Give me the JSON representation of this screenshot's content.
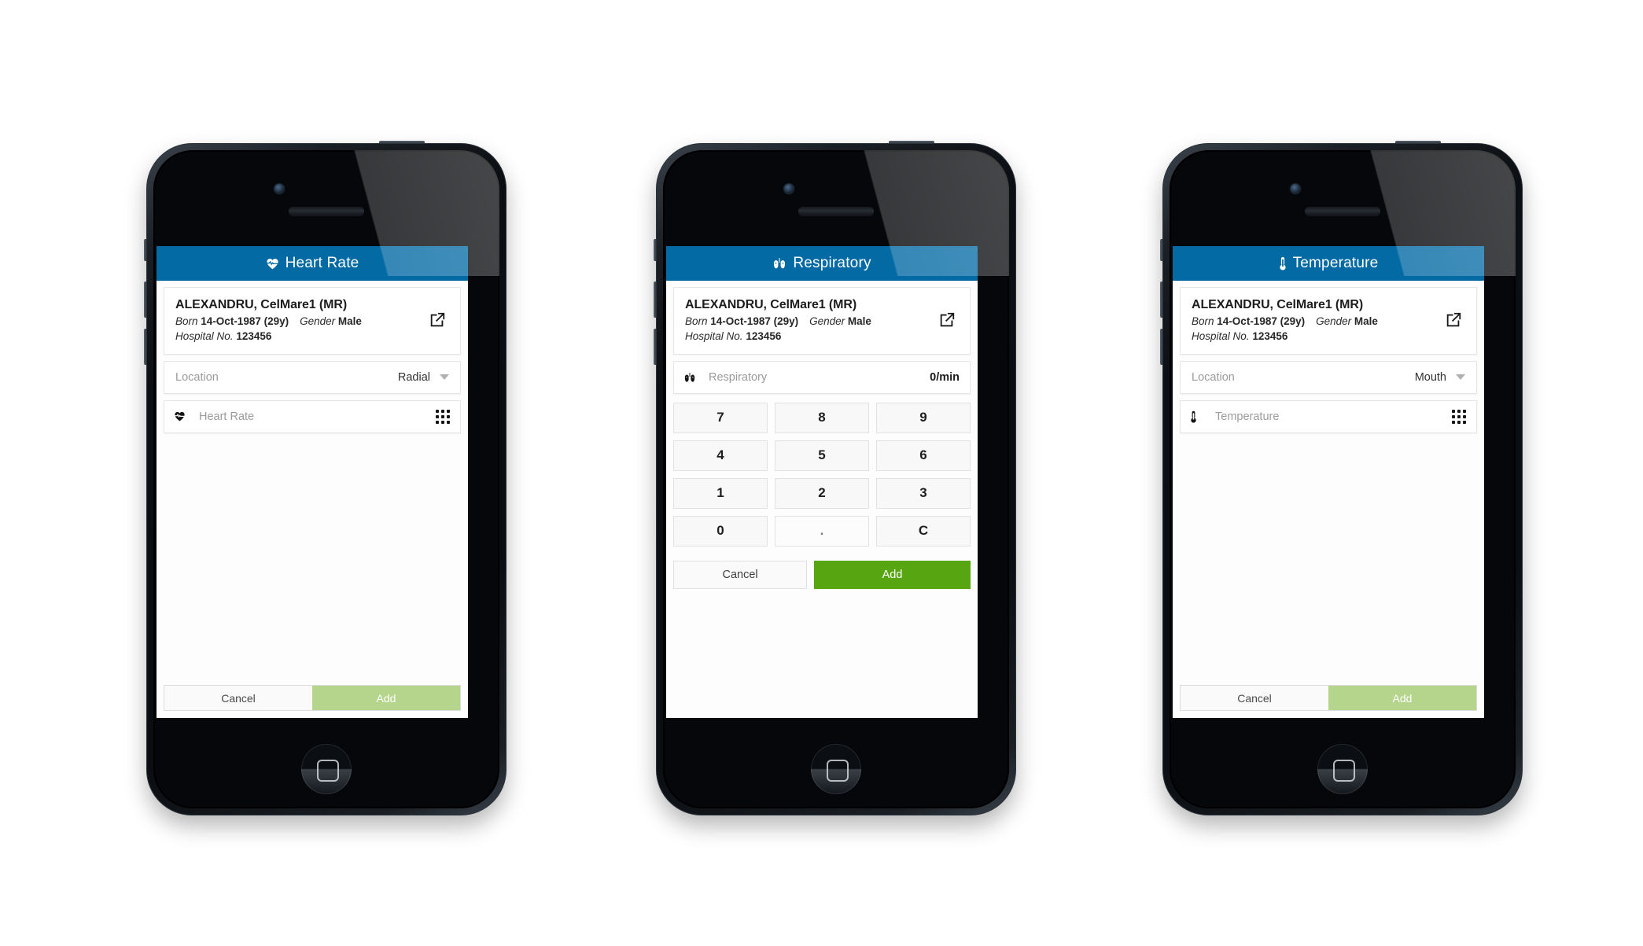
{
  "colors": {
    "appbar_blue": "#046aa4",
    "add_green": "#58a512",
    "add_green_disabled": "#b5d58c",
    "device_black": "#0d1116"
  },
  "patient": {
    "name": "ALEXANDRU, CelMare1 (MR)",
    "born_label": "Born",
    "born_value": "14-Oct-1987 (29y)",
    "gender_label": "Gender",
    "gender_value": "Male",
    "hospital_label": "Hospital No.",
    "hospital_value": "123456",
    "open_icon": "external-link-icon"
  },
  "phones": [
    {
      "id": "heart-rate",
      "appbar": {
        "title": "Heart Rate",
        "icon": "heart-pulse-icon"
      },
      "location": {
        "label": "Location",
        "value": "Radial",
        "caret_icon": "chevron-down-icon"
      },
      "measure": {
        "label": "Heart Rate",
        "icon": "heart-pulse-icon",
        "value": "",
        "keypad_icon": "keypad-grid-icon"
      },
      "actions": {
        "cancel": "Cancel",
        "add": "Add",
        "add_enabled": false
      }
    },
    {
      "id": "respiratory",
      "appbar": {
        "title": "Respiratory",
        "icon": "lungs-icon"
      },
      "measure": {
        "label": "Respiratory",
        "icon": "lungs-icon",
        "value": "0/min"
      },
      "keypad": {
        "keys": [
          "7",
          "8",
          "9",
          "4",
          "5",
          "6",
          "1",
          "2",
          "3",
          "0",
          ".",
          "C"
        ],
        "cancel": "Cancel",
        "add": "Add",
        "add_enabled": true
      }
    },
    {
      "id": "temperature",
      "appbar": {
        "title": "Temperature",
        "icon": "thermometer-icon"
      },
      "location": {
        "label": "Location",
        "value": "Mouth",
        "caret_icon": "chevron-down-icon"
      },
      "measure": {
        "label": "Temperature",
        "icon": "thermometer-icon",
        "value": "",
        "keypad_icon": "keypad-grid-icon"
      },
      "actions": {
        "cancel": "Cancel",
        "add": "Add",
        "add_enabled": false
      }
    }
  ]
}
